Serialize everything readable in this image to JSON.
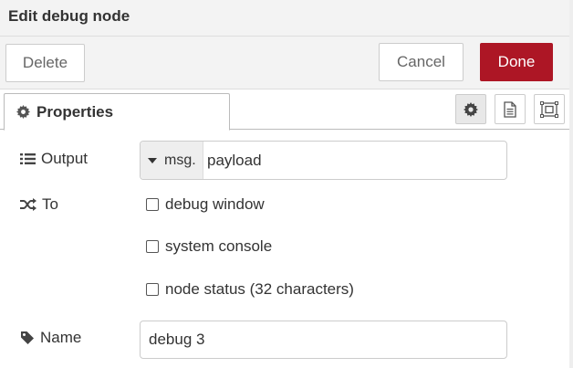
{
  "dialog": {
    "title": "Edit debug node"
  },
  "toolbar": {
    "delete_label": "Delete",
    "cancel_label": "Cancel",
    "done_label": "Done"
  },
  "tabs": {
    "properties_label": "Properties",
    "buttons": [
      {
        "icon": "gear-icon",
        "selected": true
      },
      {
        "icon": "document-icon",
        "selected": false
      },
      {
        "icon": "appearance-icon",
        "selected": false
      }
    ]
  },
  "form": {
    "output": {
      "label": "Output",
      "type_prefix": "msg.",
      "value": "payload"
    },
    "to": {
      "label": "To",
      "options": [
        {
          "label": "debug window",
          "checked": false
        },
        {
          "label": "system console",
          "checked": false
        },
        {
          "label": "node status (32 characters)",
          "checked": false
        }
      ]
    },
    "name": {
      "label": "Name",
      "value": "debug 3"
    }
  },
  "colors": {
    "accent": "#ad1625",
    "header_bg": "#f3f3f3",
    "border": "#cccccc"
  }
}
